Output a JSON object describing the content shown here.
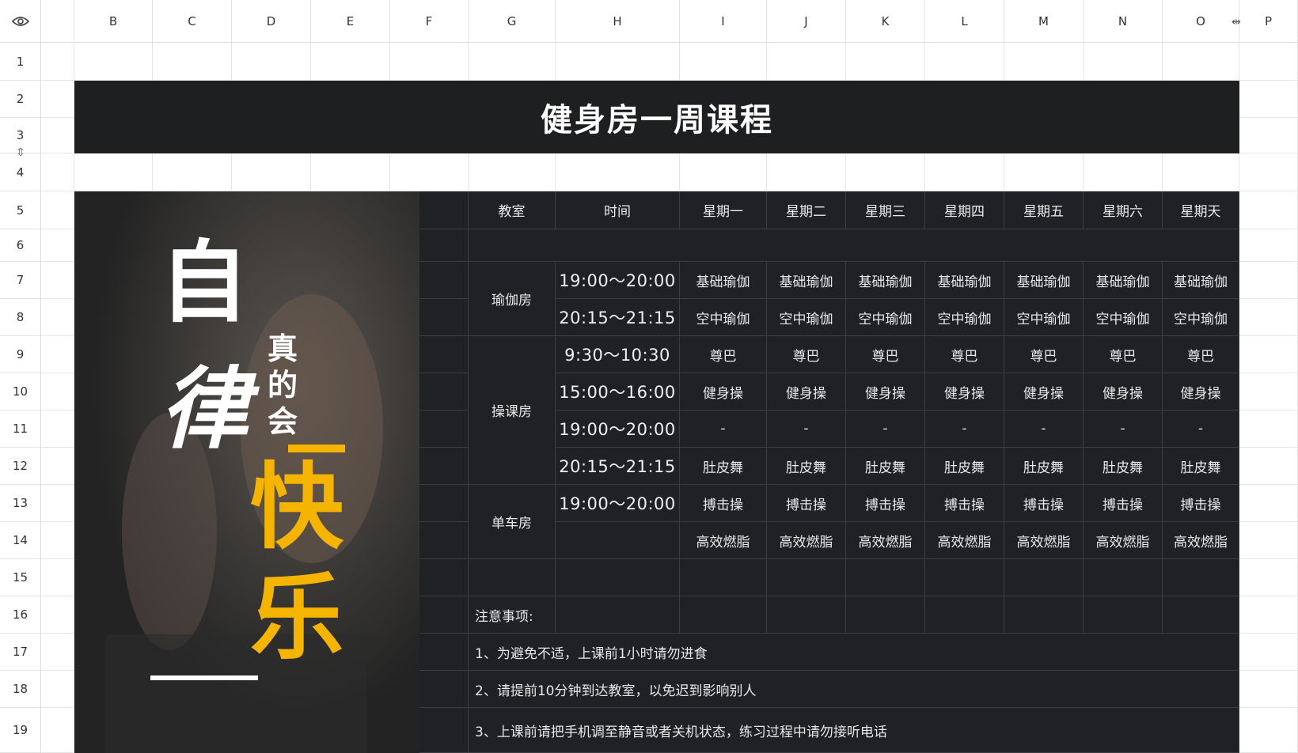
{
  "sheet": {
    "columns": [
      "B",
      "C",
      "D",
      "E",
      "F",
      "G",
      "H",
      "I",
      "J",
      "K",
      "L",
      "M",
      "N",
      "O",
      "P"
    ],
    "rows": [
      "1",
      "2",
      "3",
      "4",
      "5",
      "6",
      "7",
      "8",
      "9",
      "10",
      "11",
      "12",
      "13",
      "14",
      "15",
      "16",
      "17",
      "18",
      "19"
    ]
  },
  "title": "健身房一周课程",
  "poster": {
    "line1": "自",
    "line2": "律",
    "side": [
      "真",
      "的",
      "会"
    ],
    "big1": "快",
    "big2": "乐"
  },
  "schedule": {
    "headers": [
      "教室",
      "时间",
      "星期一",
      "星期二",
      "星期三",
      "星期四",
      "星期五",
      "星期六",
      "星期天"
    ],
    "rooms": [
      {
        "name": "瑜伽房",
        "slots": [
          {
            "time": "19:00～20:00",
            "classes": [
              "基础瑜伽",
              "基础瑜伽",
              "基础瑜伽",
              "基础瑜伽",
              "基础瑜伽",
              "基础瑜伽",
              "基础瑜伽"
            ]
          },
          {
            "time": "20:15～21:15",
            "classes": [
              "空中瑜伽",
              "空中瑜伽",
              "空中瑜伽",
              "空中瑜伽",
              "空中瑜伽",
              "空中瑜伽",
              "空中瑜伽"
            ]
          }
        ]
      },
      {
        "name": "操课房",
        "slots": [
          {
            "time": "9:30～10:30",
            "classes": [
              "尊巴",
              "尊巴",
              "尊巴",
              "尊巴",
              "尊巴",
              "尊巴",
              "尊巴"
            ]
          },
          {
            "time": "15:00～16:00",
            "classes": [
              "健身操",
              "健身操",
              "健身操",
              "健身操",
              "健身操",
              "健身操",
              "健身操"
            ]
          },
          {
            "time": "19:00～20:00",
            "classes": [
              "-",
              "-",
              "-",
              "-",
              "-",
              "-",
              "-"
            ]
          },
          {
            "time": "20:15～21:15",
            "classes": [
              "肚皮舞",
              "肚皮舞",
              "肚皮舞",
              "肚皮舞",
              "肚皮舞",
              "肚皮舞",
              "肚皮舞"
            ]
          }
        ]
      },
      {
        "name": "单车房",
        "slots": [
          {
            "time": "19:00～20:00",
            "classes": [
              "搏击操",
              "搏击操",
              "搏击操",
              "搏击操",
              "搏击操",
              "搏击操",
              "搏击操"
            ]
          },
          {
            "time": "",
            "classes": [
              "高效燃脂",
              "高效燃脂",
              "高效燃脂",
              "高效燃脂",
              "高效燃脂",
              "高效燃脂",
              "高效燃脂"
            ]
          }
        ]
      }
    ]
  },
  "notes": {
    "heading": "注意事项:",
    "items": [
      "1、为避免不适，上课前1小时请勿进食",
      "2、请提前10分钟到达教室，以免迟到影响别人",
      "3、上课前请把手机调至静音或者关机状态，练习过程中请勿接听电话"
    ]
  },
  "colors": {
    "dark": "#1f2124",
    "accent": "#f5b400",
    "grid": "#e6e6e6"
  },
  "icons": {
    "corner": "eye-icon"
  }
}
